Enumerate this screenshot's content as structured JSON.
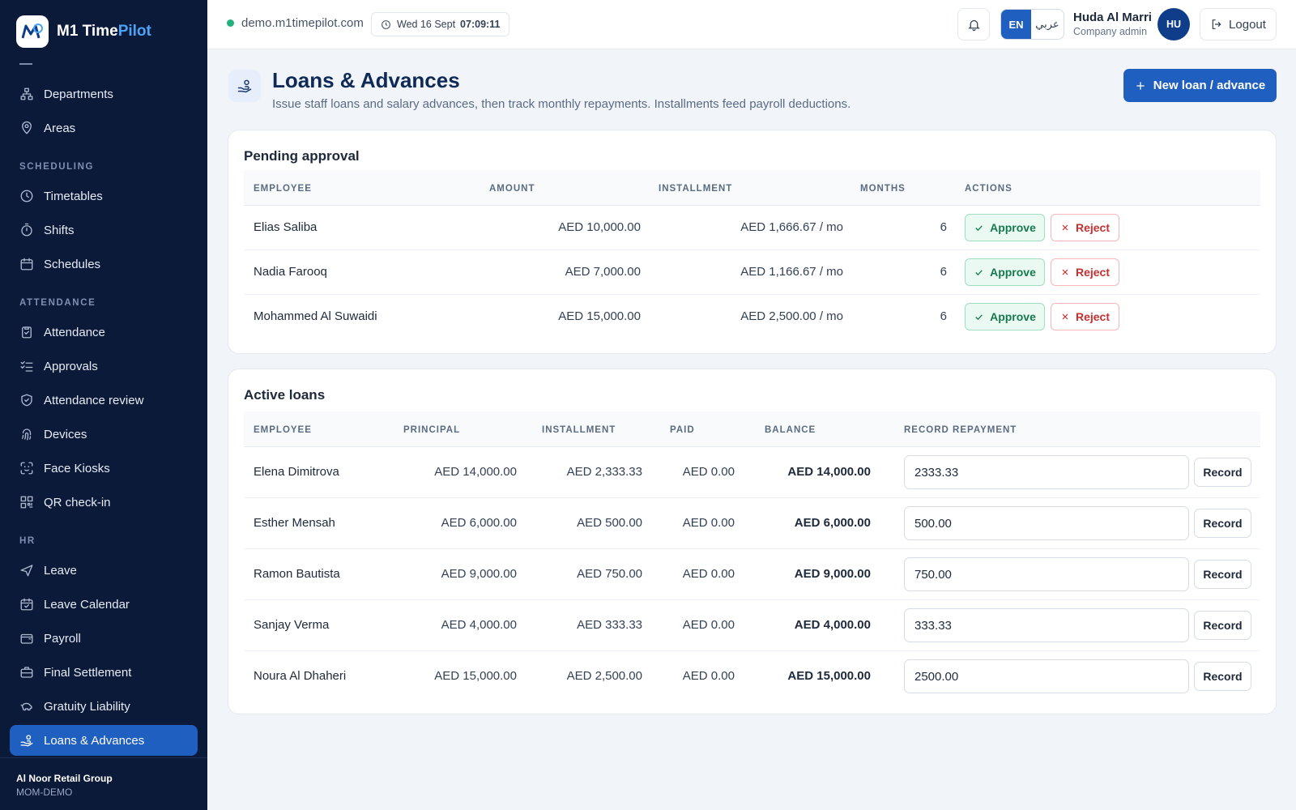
{
  "app": {
    "name_main": "M1 Time",
    "name_accent": "Pilot"
  },
  "topbar": {
    "domain": "demo.m1timepilot.com",
    "date": "Wed 16 Sept",
    "time": "07:09:11",
    "lang_en": "EN",
    "lang_ar": "عربي",
    "user_name": "Huda Al Marri",
    "user_role": "Company admin",
    "avatar_initials": "HU",
    "logout_label": "Logout"
  },
  "sidebar": {
    "sections": {
      "scheduling": "SCHEDULING",
      "attendance": "ATTENDANCE",
      "hr": "HR"
    },
    "items": {
      "departments": "Departments",
      "areas": "Areas",
      "timetables": "Timetables",
      "shifts": "Shifts",
      "schedules": "Schedules",
      "attendance": "Attendance",
      "approvals": "Approvals",
      "attendance_review": "Attendance review",
      "devices": "Devices",
      "face_kiosks": "Face Kiosks",
      "qr_checkin": "QR check-in",
      "leave": "Leave",
      "leave_calendar": "Leave Calendar",
      "payroll": "Payroll",
      "final_settlement": "Final Settlement",
      "gratuity_liability": "Gratuity Liability",
      "loans_advances": "Loans & Advances"
    },
    "org_name": "Al Noor Retail Group",
    "org_code": "MOM-DEMO"
  },
  "page": {
    "title": "Loans & Advances",
    "subtitle": "Issue staff loans and salary advances, then track monthly repayments. Installments feed payroll deductions.",
    "new_button": "New loan / advance"
  },
  "pending": {
    "title": "Pending approval",
    "headers": {
      "employee": "EMPLOYEE",
      "amount": "AMOUNT",
      "installment": "INSTALLMENT",
      "months": "MONTHS",
      "actions": "ACTIONS"
    },
    "approve_label": "Approve",
    "reject_label": "Reject",
    "rows": [
      {
        "employee": "Elias Saliba",
        "amount": "AED 10,000.00",
        "installment": "AED 1,666.67 / mo",
        "months": "6"
      },
      {
        "employee": "Nadia Farooq",
        "amount": "AED 7,000.00",
        "installment": "AED 1,166.67 / mo",
        "months": "6"
      },
      {
        "employee": "Mohammed Al Suwaidi",
        "amount": "AED 15,000.00",
        "installment": "AED 2,500.00 / mo",
        "months": "6"
      }
    ]
  },
  "active": {
    "title": "Active loans",
    "headers": {
      "employee": "EMPLOYEE",
      "principal": "PRINCIPAL",
      "installment": "INSTALLMENT",
      "paid": "PAID",
      "balance": "BALANCE",
      "record": "RECORD REPAYMENT"
    },
    "record_label": "Record",
    "rows": [
      {
        "employee": "Elena Dimitrova",
        "principal": "AED 14,000.00",
        "installment": "AED 2,333.33",
        "paid": "AED 0.00",
        "balance": "AED 14,000.00",
        "repayment": "2333.33"
      },
      {
        "employee": "Esther Mensah",
        "principal": "AED 6,000.00",
        "installment": "AED 500.00",
        "paid": "AED 0.00",
        "balance": "AED 6,000.00",
        "repayment": "500.00"
      },
      {
        "employee": "Ramon Bautista",
        "principal": "AED 9,000.00",
        "installment": "AED 750.00",
        "paid": "AED 0.00",
        "balance": "AED 9,000.00",
        "repayment": "750.00"
      },
      {
        "employee": "Sanjay Verma",
        "principal": "AED 4,000.00",
        "installment": "AED 333.33",
        "paid": "AED 0.00",
        "balance": "AED 4,000.00",
        "repayment": "333.33"
      },
      {
        "employee": "Noura Al Dhaheri",
        "principal": "AED 15,000.00",
        "installment": "AED 2,500.00",
        "paid": "AED 0.00",
        "balance": "AED 15,000.00",
        "repayment": "2500.00"
      }
    ]
  }
}
